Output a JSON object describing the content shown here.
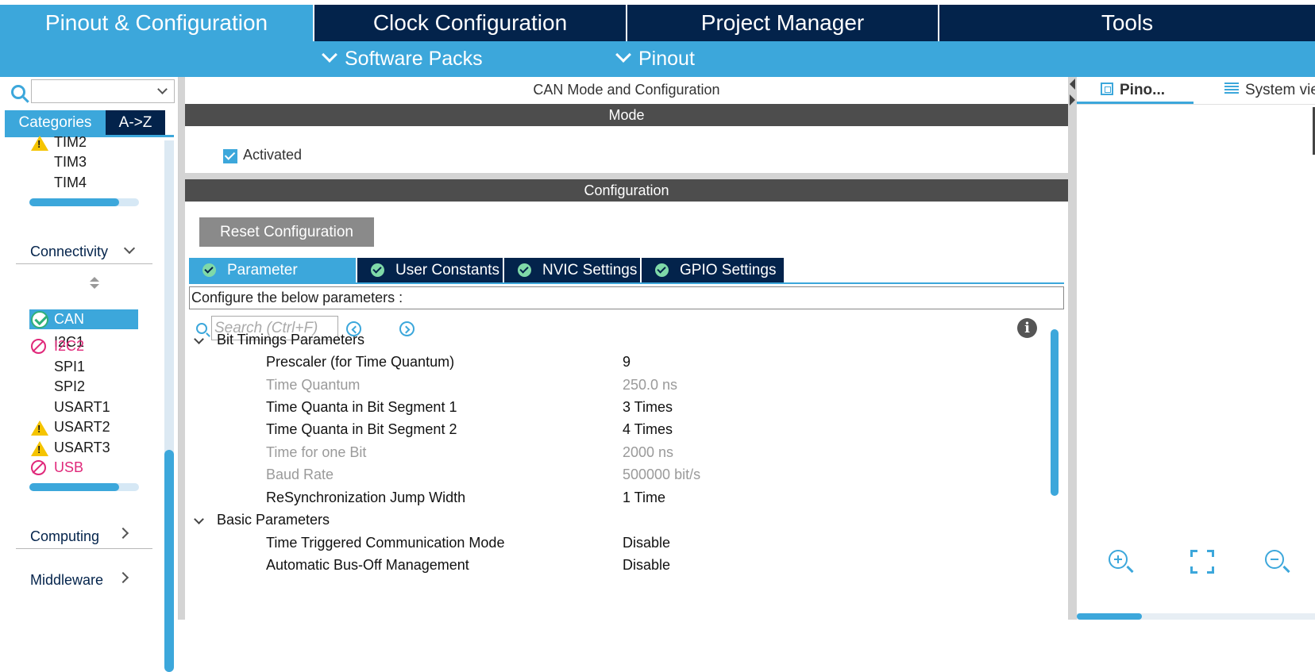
{
  "top_tabs": [
    "Pinout & Configuration",
    "Clock Configuration",
    "Project Manager",
    "Tools"
  ],
  "sub_menu": [
    "Software Packs",
    "Pinout"
  ],
  "left": {
    "search_value": "",
    "tab_categories": "Categories",
    "tab_az": "A->Z",
    "timers": [
      {
        "label": "TIM2",
        "status": "warning"
      },
      {
        "label": "TIM3",
        "status": "none"
      },
      {
        "label": "TIM4",
        "status": "none"
      }
    ],
    "connectivity_header": "Connectivity",
    "connectivity": [
      {
        "label": "CAN",
        "status": "ok",
        "selected": true
      },
      {
        "label": "I2C1",
        "status": "none"
      },
      {
        "label": "I2C2",
        "status": "disabled"
      },
      {
        "label": "SPI1",
        "status": "none"
      },
      {
        "label": "SPI2",
        "status": "none"
      },
      {
        "label": "USART1",
        "status": "none"
      },
      {
        "label": "USART2",
        "status": "warning"
      },
      {
        "label": "USART3",
        "status": "warning"
      },
      {
        "label": "USB",
        "status": "disabled"
      }
    ],
    "computing_header": "Computing",
    "middleware_header": "Middleware"
  },
  "center": {
    "title": "CAN Mode and Configuration",
    "mode_header": "Mode",
    "activated_label": "Activated",
    "activated_checked": true,
    "configuration_header": "Configuration",
    "reset_button": "Reset Configuration",
    "param_tabs": [
      "Parameter Settings",
      "User Constants",
      "NVIC Settings",
      "GPIO Settings"
    ],
    "configure_text": "Configure the below parameters :",
    "search_placeholder": "Search (Ctrl+F)",
    "groups": [
      {
        "name": "Bit Timings Parameters",
        "rows": [
          {
            "name": "Prescaler (for Time Quantum)",
            "value": "9",
            "readonly": false
          },
          {
            "name": "Time Quantum",
            "value": "250.0 ns",
            "readonly": true
          },
          {
            "name": "Time Quanta in Bit Segment 1",
            "value": "3 Times",
            "readonly": false
          },
          {
            "name": "Time Quanta in Bit Segment 2",
            "value": "4 Times",
            "readonly": false
          },
          {
            "name": "Time for one Bit",
            "value": "2000 ns",
            "readonly": true
          },
          {
            "name": "Baud Rate",
            "value": "500000 bit/s",
            "readonly": true
          },
          {
            "name": "ReSynchronization Jump Width",
            "value": "1 Time",
            "readonly": false
          }
        ]
      },
      {
        "name": "Basic Parameters",
        "rows": [
          {
            "name": "Time Triggered Communication Mode",
            "value": "Disable",
            "readonly": false
          },
          {
            "name": "Automatic Bus-Off Management",
            "value": "Disable",
            "readonly": false
          }
        ]
      }
    ]
  },
  "right": {
    "tab_pinout": "Pino...",
    "tab_system": "System view"
  },
  "colors": {
    "accent": "#3ca7db",
    "navy": "#03234b",
    "warning": "#f5c400",
    "disabled": "#e0287a",
    "ok": "#2fb07a"
  }
}
